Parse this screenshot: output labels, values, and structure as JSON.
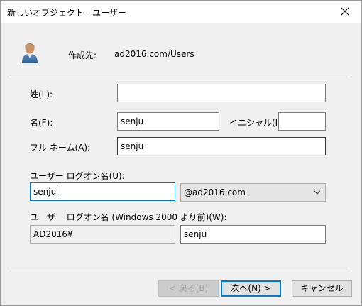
{
  "window": {
    "title": "新しいオブジェクト - ユーザー"
  },
  "header": {
    "icon": "user-icon",
    "create_in_label": "作成先:",
    "create_in_value": "ad2016.com/Users"
  },
  "form": {
    "last_name": {
      "label": "姓(L):",
      "value": ""
    },
    "first_name": {
      "label": "名(F):",
      "value": "senju"
    },
    "initials": {
      "label": "イニシャル(I):",
      "value": ""
    },
    "full_name": {
      "label": "フル ネーム(A):",
      "value": "senju"
    },
    "logon_name": {
      "label": "ユーザー ログオン名(U):",
      "value": "senju"
    },
    "domain_select": {
      "value": "@ad2016.com"
    },
    "pre2000_label": "ユーザー ログオン名 (Windows 2000 より前)(W):",
    "pre2000_domain": "AD2016¥",
    "pre2000_name": "senju"
  },
  "buttons": {
    "back": "< 戻る(B)",
    "next": "次へ(N) >",
    "cancel": "キャンセル"
  },
  "colors": {
    "accent": "#0078d7",
    "dialog_bg": "#f0f0f0"
  }
}
